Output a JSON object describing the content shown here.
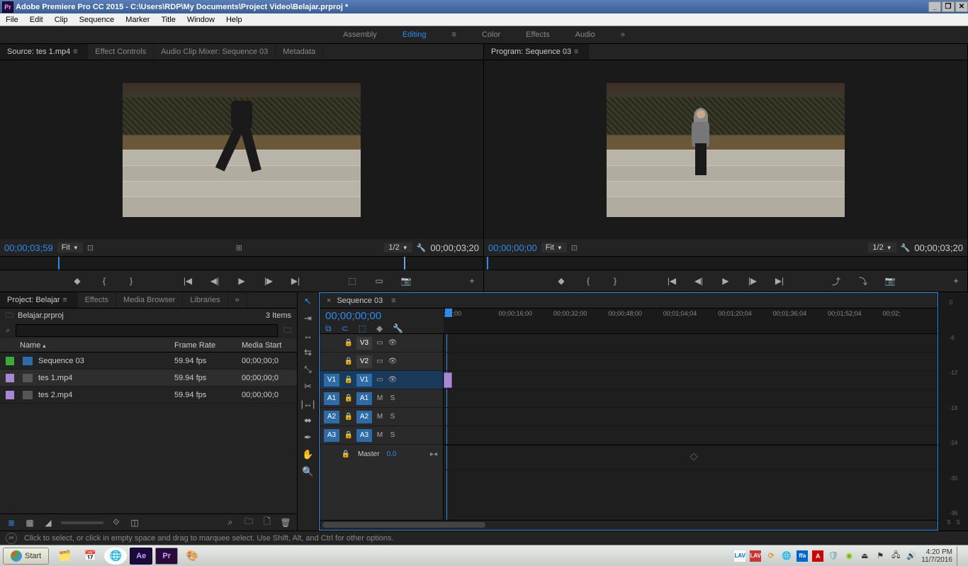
{
  "window": {
    "title": "Adobe Premiere Pro CC 2015 - C:\\Users\\RDP\\My Documents\\Project Video\\Belajar.prproj *",
    "appicon": "Pr"
  },
  "menu": [
    "File",
    "Edit",
    "Clip",
    "Sequence",
    "Marker",
    "Title",
    "Window",
    "Help"
  ],
  "workspaces": {
    "items": [
      "Assembly",
      "Editing",
      "Color",
      "Effects",
      "Audio"
    ],
    "active": "Editing"
  },
  "source": {
    "tabs": [
      "Source: tes 1.mp4",
      "Effect Controls",
      "Audio Clip Mixer: Sequence 03",
      "Metadata"
    ],
    "active": 0,
    "timecode_left": "00;00;03;59",
    "fit": "Fit",
    "resolution": "1/2",
    "timecode_right": "00;00;03;20"
  },
  "program": {
    "title": "Program: Sequence 03",
    "timecode_left": "00;00;00;00",
    "fit": "Fit",
    "resolution": "1/2",
    "timecode_right": "00;00;03;20"
  },
  "project": {
    "tabs": [
      "Project: Belajar",
      "Effects",
      "Media Browser",
      "Libraries"
    ],
    "active": 0,
    "filename": "Belajar.prproj",
    "item_count": "3 Items",
    "search_placeholder": "",
    "headers": {
      "name": "Name",
      "framerate": "Frame Rate",
      "mediastart": "Media Start"
    },
    "rows": [
      {
        "swatch": "#3aaa3a",
        "name": "Sequence 03",
        "fr": "59.94 fps",
        "ms": "00;00;00;0"
      },
      {
        "swatch": "#a888d0",
        "name": "tes 1.mp4",
        "fr": "59.94 fps",
        "ms": "00;00;00;0"
      },
      {
        "swatch": "#a888d0",
        "name": "tes 2.mp4",
        "fr": "59.94 fps",
        "ms": "00;00;00;0"
      }
    ]
  },
  "timeline": {
    "tab": "Sequence 03",
    "timecode": "00;00;00;00",
    "ruler": [
      ";00;00",
      "00;00;16;00",
      "00;00;32;00",
      "00;00;48;00",
      "00;01;04;04",
      "00;01;20;04",
      "00;01;36;04",
      "00;01;52;04",
      "00;02;"
    ],
    "video_tracks": [
      "V3",
      "V2",
      "V1"
    ],
    "audio_tracks": [
      "A1",
      "A2",
      "A3"
    ],
    "src_v": "V1",
    "src_a": [
      "A1",
      "A2",
      "A3"
    ],
    "master": "Master",
    "master_val": "0.0"
  },
  "meters": {
    "ticks": [
      "0",
      "-6",
      "-12",
      "-18",
      "-24",
      "-30",
      "-36"
    ],
    "foot_l": "S",
    "foot_r": "S"
  },
  "status": {
    "hint": "Click to select, or click in empty space and drag to marquee select. Use Shift, Alt, and Ctrl for other options."
  },
  "taskbar": {
    "start": "Start",
    "clock_time": "4:20 PM",
    "clock_date": "11/7/2016"
  }
}
